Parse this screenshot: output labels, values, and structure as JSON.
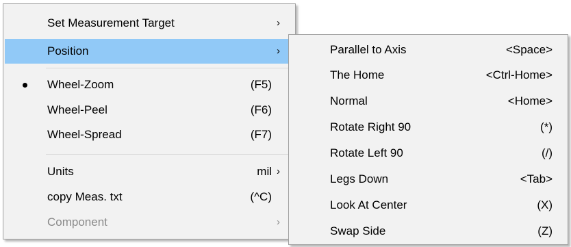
{
  "main_menu": {
    "items": [
      {
        "label": "Set Measurement Target",
        "shortcut": "",
        "submenu": true
      },
      {
        "label": "Position",
        "shortcut": "",
        "submenu": true,
        "highlighted": true
      },
      {
        "label": "Wheel-Zoom",
        "shortcut": "(F5)",
        "checked": true
      },
      {
        "label": "Wheel-Peel",
        "shortcut": "(F6)"
      },
      {
        "label": "Wheel-Spread",
        "shortcut": "(F7)"
      },
      {
        "label": "Units",
        "shortcut": "mil",
        "submenu": true
      },
      {
        "label": "copy Meas. txt",
        "shortcut": "(^C)"
      },
      {
        "label": "Component",
        "shortcut": "",
        "submenu": true,
        "disabled": true
      }
    ],
    "arrow_glyph": "›"
  },
  "sub_menu": {
    "items": [
      {
        "label": "Parallel to Axis",
        "shortcut": "<Space>"
      },
      {
        "label": "The Home",
        "shortcut": "<Ctrl-Home>"
      },
      {
        "label": "Normal",
        "shortcut": "<Home>"
      },
      {
        "label": "Rotate Right 90",
        "shortcut": "(*)"
      },
      {
        "label": "Rotate Left 90",
        "shortcut": "(/)"
      },
      {
        "label": "Legs Down",
        "shortcut": "<Tab>"
      },
      {
        "label": "Look At Center",
        "shortcut": "(X)"
      },
      {
        "label": "Swap Side",
        "shortcut": "(Z)"
      }
    ]
  },
  "colors": {
    "menu_background": "#f2f2f2",
    "highlight": "#91c9f7",
    "disabled_text": "#8a8a8a",
    "border": "#a0a0a0"
  }
}
